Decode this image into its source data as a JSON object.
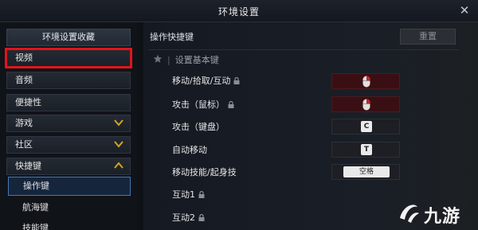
{
  "window": {
    "title": "环境设置",
    "close_glyph": "✕"
  },
  "sidebar": {
    "header": "环境设置收藏",
    "items": [
      {
        "label": "视频",
        "expanded": false,
        "has_chevron": false
      },
      {
        "label": "音频",
        "expanded": false,
        "has_chevron": false
      },
      {
        "label": "便捷性",
        "expanded": false,
        "has_chevron": false
      },
      {
        "label": "游戏",
        "expanded": false,
        "has_chevron": true
      },
      {
        "label": "社区",
        "expanded": false,
        "has_chevron": true
      },
      {
        "label": "快捷键",
        "expanded": true,
        "has_chevron": true
      }
    ],
    "subitems": [
      {
        "label": "操作键",
        "active": true
      },
      {
        "label": "航海键",
        "active": false
      },
      {
        "label": "技能键",
        "active": false
      }
    ]
  },
  "main": {
    "section_title": "操作快捷键",
    "reset_label": "重置",
    "basic_title": "设置基本键",
    "rows": [
      {
        "label": "移动/拾取/互动",
        "locked": true,
        "binding": "mouse-right-button",
        "binding_type": "mouse"
      },
      {
        "label": "攻击（鼠标）",
        "locked": true,
        "binding": "mouse-right-button",
        "binding_type": "mouse"
      },
      {
        "label": "攻击（键盘）",
        "locked": false,
        "binding": "C",
        "binding_type": "key"
      },
      {
        "label": "自动移动",
        "locked": false,
        "binding": "T",
        "binding_type": "key"
      },
      {
        "label": "移动技能/起身技",
        "locked": false,
        "binding": "空格",
        "binding_type": "space"
      },
      {
        "label": "互动1",
        "locked": true,
        "binding": "",
        "binding_type": "none"
      },
      {
        "label": "互动2",
        "locked": true,
        "binding": "",
        "binding_type": "none"
      }
    ]
  },
  "watermark": {
    "text": "九游"
  },
  "colors": {
    "highlight_red": "#e0151a",
    "active_blue": "#3f78b6",
    "chevron_gold": "#d4a520",
    "mouse_red": "#c8242b"
  }
}
